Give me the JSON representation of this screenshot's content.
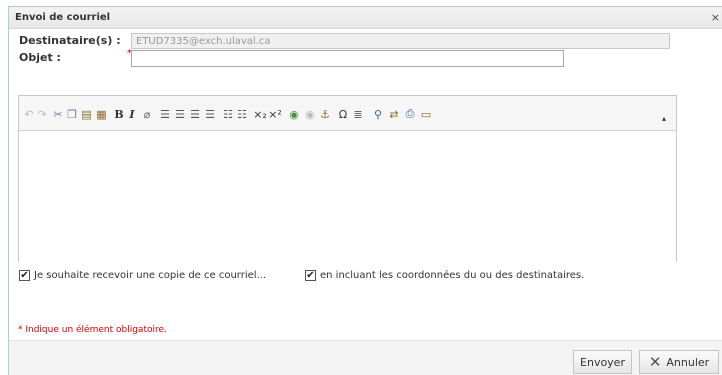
{
  "dialog": {
    "title": "Envoi de courriel",
    "close_glyph": "×"
  },
  "form": {
    "recipients_label": "Destinataire(s) :",
    "recipients_value": "ETUD7335@exch.ulaval.ca",
    "subject_label": "Objet :",
    "required_marker": "*",
    "subject_value": ""
  },
  "toolbar": {
    "icons": [
      "undo-icon",
      "redo-icon",
      "cut-icon",
      "copy-icon",
      "paste-icon",
      "paste-word-icon",
      "bold-icon",
      "italic-icon",
      "remove-format-icon",
      "align-left-icon",
      "align-center-icon",
      "align-right-icon",
      "align-justify-icon",
      "bulleted-list-icon",
      "numbered-list-icon",
      "subscript-icon",
      "superscript-icon",
      "link-icon",
      "unlink-icon",
      "anchor-icon",
      "special-char-icon",
      "horizontal-rule-icon",
      "find-icon",
      "replace-icon",
      "print-icon",
      "source-icon",
      "collapse-toolbar-icon"
    ],
    "bold_glyph": "B",
    "italic_glyph": "I",
    "omega_glyph": "Ω"
  },
  "options": {
    "copy_label": "Je souhaite recevoir une copie de ce courriel...",
    "copy_checked": true,
    "include_label": "en incluant les coordonnées du ou des destinataires.",
    "include_checked": true
  },
  "note": {
    "required_text": "* Indique un élément obligatoire."
  },
  "footer": {
    "send_label": "Envoyer",
    "cancel_label": "Annuler"
  },
  "colors": {
    "required": "#dd0000",
    "border": "#b9c7d6"
  }
}
